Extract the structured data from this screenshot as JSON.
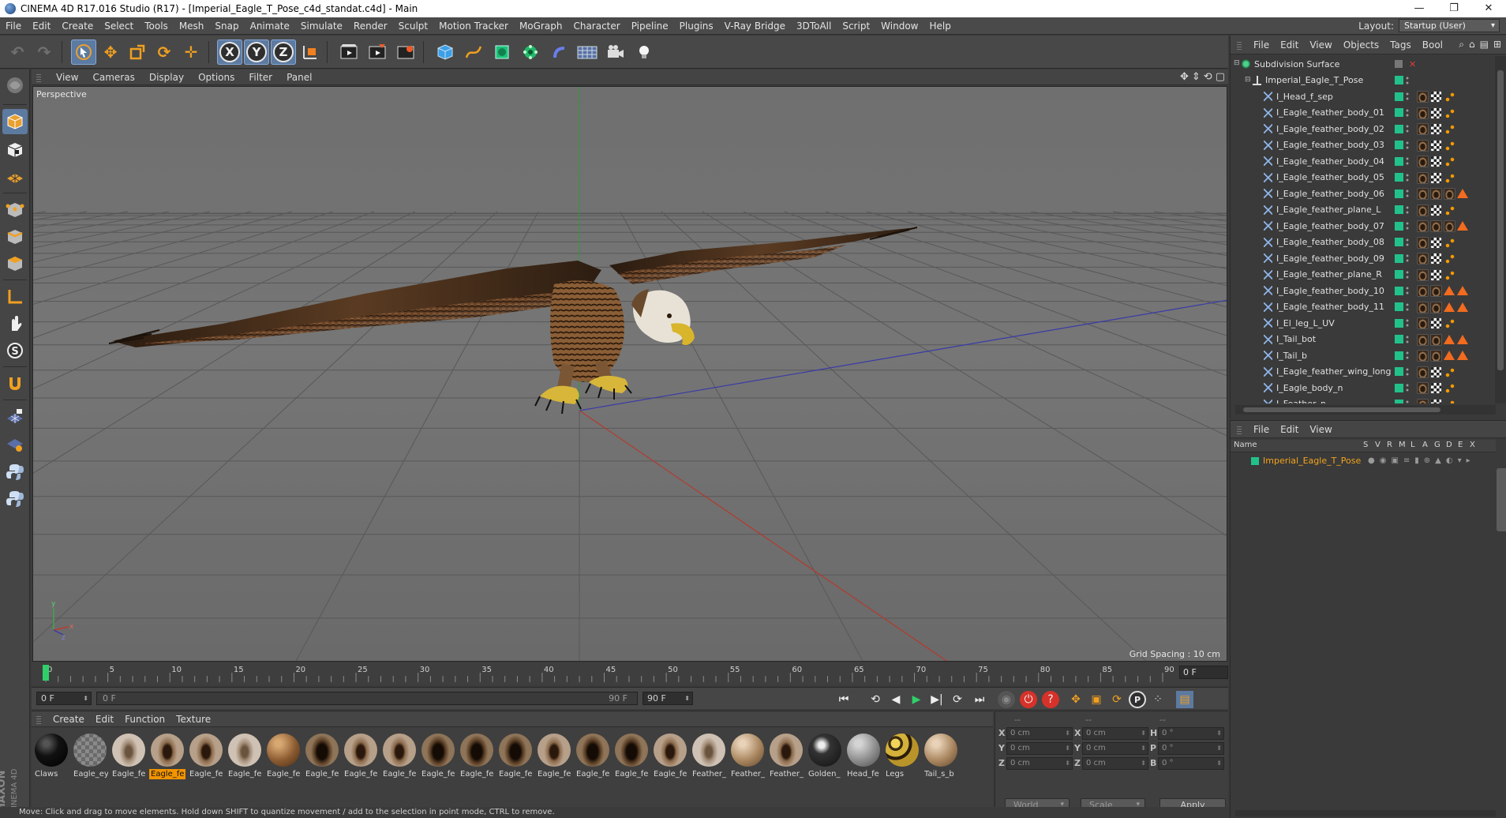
{
  "window": {
    "title": "CINEMA 4D R17.016 Studio (R17) - [Imperial_Eagle_T_Pose_c4d_standat.c4d] - Main",
    "controls": [
      "—",
      "❐",
      "✕"
    ]
  },
  "menubar": {
    "items": [
      "File",
      "Edit",
      "Create",
      "Select",
      "Tools",
      "Mesh",
      "Snap",
      "Animate",
      "Simulate",
      "Render",
      "Sculpt",
      "Motion Tracker",
      "MoGraph",
      "Character",
      "Pipeline",
      "Plugins",
      "V-Ray Bridge",
      "3DToAll",
      "Script",
      "Window",
      "Help"
    ],
    "layout_label": "Layout:",
    "layout_value": "Startup (User)"
  },
  "viewport": {
    "menu": [
      "View",
      "Cameras",
      "Display",
      "Options",
      "Filter",
      "Panel"
    ],
    "label": "Perspective",
    "grid_spacing": "Grid Spacing : 10 cm",
    "axis_labels": [
      "y",
      "x",
      "z"
    ]
  },
  "timeline": {
    "ticks": [
      "0",
      "5",
      "10",
      "15",
      "20",
      "25",
      "30",
      "35",
      "40",
      "45",
      "50",
      "55",
      "60",
      "65",
      "70",
      "75",
      "80",
      "85",
      "90"
    ],
    "current_frame": "0 F"
  },
  "transport": {
    "start_field": "0 F",
    "range_start": "0 F",
    "range_end": "90 F",
    "end_field": "90 F"
  },
  "materials": {
    "menu": [
      "Create",
      "Edit",
      "Function",
      "Texture"
    ],
    "items": [
      {
        "name": "Claws",
        "look": "black"
      },
      {
        "name": "Eagle_ey",
        "look": "checker"
      },
      {
        "name": "Eagle_fe",
        "look": "feather-light"
      },
      {
        "name": "Eagle_fe",
        "look": "feather",
        "selected": true
      },
      {
        "name": "Eagle_fe",
        "look": "feather"
      },
      {
        "name": "Eagle_fe",
        "look": "feather-light"
      },
      {
        "name": "Eagle_fe",
        "look": "brown"
      },
      {
        "name": "Eagle_fe",
        "look": "feather-dark"
      },
      {
        "name": "Eagle_fe",
        "look": "feather"
      },
      {
        "name": "Eagle_fe",
        "look": "feather"
      },
      {
        "name": "Eagle_fe",
        "look": "feather-dark"
      },
      {
        "name": "Eagle_fe",
        "look": "feather-dark"
      },
      {
        "name": "Eagle_fe",
        "look": "feather-dark"
      },
      {
        "name": "Eagle_fe",
        "look": "feather"
      },
      {
        "name": "Eagle_fe",
        "look": "feather-dark"
      },
      {
        "name": "Eagle_fe",
        "look": "feather-dark"
      },
      {
        "name": "Eagle_fe",
        "look": "feather"
      },
      {
        "name": "Feather_",
        "look": "feather-light"
      },
      {
        "name": "Feather_",
        "look": "tan"
      },
      {
        "name": "Feather_",
        "look": "feather"
      },
      {
        "name": "Golden_",
        "look": "dark-spot"
      },
      {
        "name": "Head_fe",
        "look": "grey"
      },
      {
        "name": "Legs",
        "look": "legs"
      },
      {
        "name": "Tail_s_b",
        "look": "tan"
      }
    ]
  },
  "coordinates": {
    "headers": [
      "--",
      "--",
      "--"
    ],
    "rows": [
      {
        "a": "X",
        "av": "0 cm",
        "b": "X",
        "bv": "0 cm",
        "c": "H",
        "cv": "0 °"
      },
      {
        "a": "Y",
        "av": "0 cm",
        "b": "Y",
        "bv": "0 cm",
        "c": "P",
        "cv": "0 °"
      },
      {
        "a": "Z",
        "av": "0 cm",
        "b": "Z",
        "bv": "0 cm",
        "c": "B",
        "cv": "0 °"
      }
    ],
    "space": "World",
    "mode": "Scale",
    "apply": "Apply"
  },
  "status": {
    "text": "Move: Click and drag to move elements. Hold down SHIFT to quantize movement / add to the selection in point mode, CTRL to remove."
  },
  "object_manager": {
    "menu": [
      "File",
      "Edit",
      "View",
      "Objects",
      "Tags",
      "Bool"
    ],
    "objects": [
      {
        "name": "Subdivision Surface",
        "level": 0,
        "kind": "subdiv",
        "tags": []
      },
      {
        "name": "Imperial_Eagle_T_Pose",
        "level": 1,
        "kind": "null",
        "tags": []
      },
      {
        "name": "I_Head_f_sep",
        "level": 2,
        "kind": "mesh",
        "tags": [
          "feather",
          "check",
          "tex"
        ]
      },
      {
        "name": "I_Eagle_feather_body_01",
        "level": 2,
        "kind": "mesh",
        "tags": [
          "feather",
          "check",
          "tex"
        ]
      },
      {
        "name": "I_Eagle_feather_body_02",
        "level": 2,
        "kind": "mesh",
        "tags": [
          "feather",
          "check",
          "tex"
        ]
      },
      {
        "name": "I_Eagle_feather_body_03",
        "level": 2,
        "kind": "mesh",
        "tags": [
          "feather",
          "check",
          "tex"
        ]
      },
      {
        "name": "I_Eagle_feather_body_04",
        "level": 2,
        "kind": "mesh",
        "tags": [
          "feather",
          "check",
          "tex"
        ]
      },
      {
        "name": "I_Eagle_feather_body_05",
        "level": 2,
        "kind": "mesh",
        "tags": [
          "feather",
          "check",
          "tex"
        ]
      },
      {
        "name": "I_Eagle_feather_body_06",
        "level": 2,
        "kind": "mesh",
        "tags": [
          "feather",
          "feather",
          "feather",
          "warn"
        ]
      },
      {
        "name": "I_Eagle_feather_plane_L",
        "level": 2,
        "kind": "mesh",
        "tags": [
          "feather",
          "check",
          "tex"
        ]
      },
      {
        "name": "I_Eagle_feather_body_07",
        "level": 2,
        "kind": "mesh",
        "tags": [
          "feather",
          "feather",
          "feather",
          "warn"
        ]
      },
      {
        "name": "I_Eagle_feather_body_08",
        "level": 2,
        "kind": "mesh",
        "tags": [
          "feather",
          "check",
          "tex"
        ]
      },
      {
        "name": "I_Eagle_feather_body_09",
        "level": 2,
        "kind": "mesh",
        "tags": [
          "feather",
          "check",
          "tex"
        ]
      },
      {
        "name": "I_Eagle_feather_plane_R",
        "level": 2,
        "kind": "mesh",
        "tags": [
          "feather",
          "check",
          "tex"
        ]
      },
      {
        "name": "I_Eagle_feather_body_10",
        "level": 2,
        "kind": "mesh",
        "tags": [
          "feather",
          "feather",
          "warn",
          "warn"
        ]
      },
      {
        "name": "I_Eagle_feather_body_11",
        "level": 2,
        "kind": "mesh",
        "tags": [
          "feather",
          "feather",
          "warn",
          "warn"
        ]
      },
      {
        "name": "I_El_leg_L_UV",
        "level": 2,
        "kind": "mesh",
        "tags": [
          "feather",
          "check",
          "tex"
        ]
      },
      {
        "name": "I_Tail_bot",
        "level": 2,
        "kind": "mesh",
        "tags": [
          "feather",
          "feather",
          "warn",
          "warn"
        ]
      },
      {
        "name": "I_Tail_b",
        "level": 2,
        "kind": "mesh",
        "tags": [
          "feather",
          "feather",
          "warn",
          "warn"
        ]
      },
      {
        "name": "I_Eagle_feather_wing_long",
        "level": 2,
        "kind": "mesh",
        "tags": [
          "feather",
          "check",
          "tex"
        ]
      },
      {
        "name": "I_Eagle_body_n",
        "level": 2,
        "kind": "mesh",
        "tags": [
          "feather",
          "check",
          "tex"
        ]
      },
      {
        "name": "I_Feather_n",
        "level": 2,
        "kind": "mesh",
        "tags": [
          "feather",
          "check",
          "tex"
        ]
      }
    ]
  },
  "layer_manager": {
    "menu": [
      "File",
      "Edit",
      "View"
    ],
    "columns": [
      "Name",
      "S",
      "V",
      "R",
      "M",
      "L",
      "A",
      "G",
      "D",
      "E",
      "X"
    ],
    "row_name": "Imperial_Eagle_T_Pose"
  },
  "colors": {
    "accent": "#5d7aa0",
    "selection": "#f29400",
    "layer_green": "#21c28a",
    "warning": "#f26b1e"
  }
}
